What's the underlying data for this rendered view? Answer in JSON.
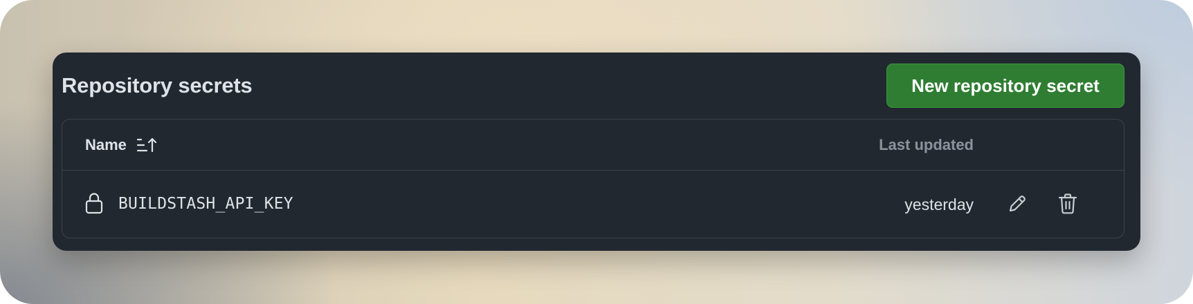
{
  "panel": {
    "title": "Repository secrets",
    "new_button_label": "New repository secret"
  },
  "table": {
    "columns": {
      "name": "Name",
      "last_updated": "Last updated"
    },
    "rows": [
      {
        "name": "BUILDSTASH_API_KEY",
        "last_updated": "yesterday"
      }
    ]
  },
  "icons": {
    "sort": "sort-ascending-icon",
    "lock": "lock-icon",
    "edit": "pencil-icon",
    "delete": "trash-icon"
  },
  "colors": {
    "panel_bg": "#212830",
    "button_green": "#2f7d32",
    "text_primary": "#dfe3e8",
    "text_muted": "#8b939c",
    "border": "#3b434d"
  }
}
